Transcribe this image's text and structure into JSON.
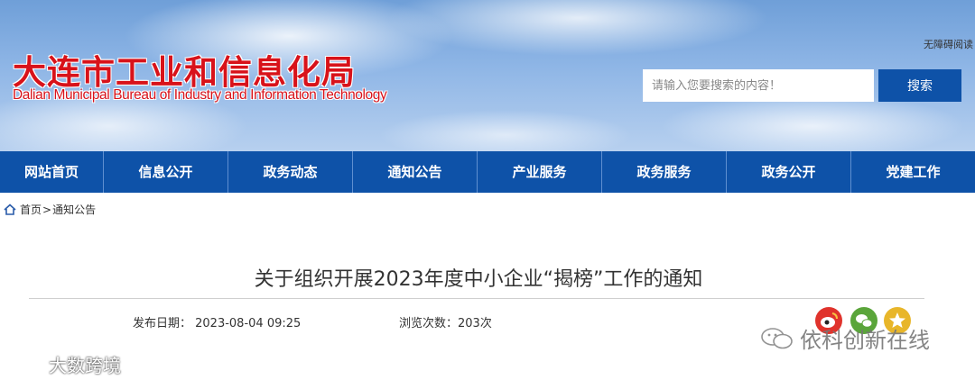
{
  "header": {
    "logo_cn": "大连市工业和信息化局",
    "logo_en": "Dalian Municipal Bureau of Industry and Information Technology",
    "accessibility_link": "无障碍阅读",
    "search": {
      "placeholder": "请输入您要搜索的内容！",
      "button_label": "搜索"
    }
  },
  "nav": {
    "items": [
      {
        "label": "网站首页"
      },
      {
        "label": "信息公开"
      },
      {
        "label": "政务动态"
      },
      {
        "label": "通知公告"
      },
      {
        "label": "产业服务"
      },
      {
        "label": "政务服务"
      },
      {
        "label": "政务公开"
      },
      {
        "label": "党建工作"
      }
    ]
  },
  "breadcrumb": {
    "home": "首页",
    "separator": ">",
    "current": "通知公告"
  },
  "article": {
    "title": "关于组织开展2023年度中小企业“揭榜”工作的通知",
    "publish_date": "发布日期： 2023-08-04  09:25",
    "views": "浏览次数：203次"
  },
  "share": {
    "icons": [
      "weibo-icon",
      "wechat-icon",
      "qzone-icon"
    ]
  },
  "watermarks": {
    "right": "依科创新在线",
    "left": "大数跨境"
  },
  "colors": {
    "nav_bg": "#0e52a8",
    "logo_red": "#d8121a"
  }
}
